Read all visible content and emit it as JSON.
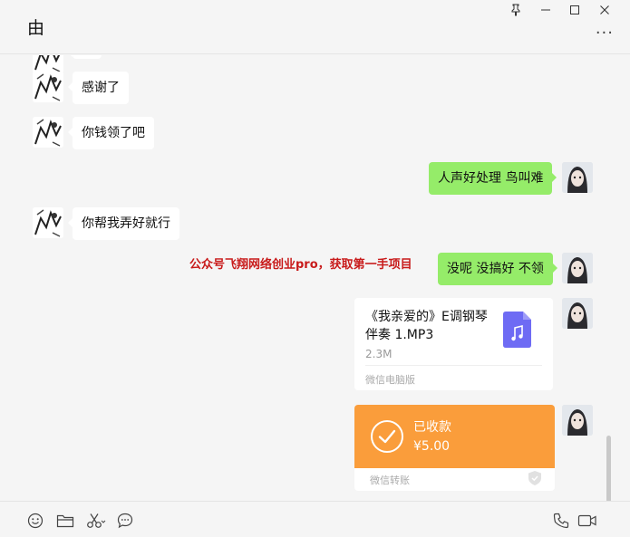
{
  "window": {
    "title": "由",
    "pin_icon": "pin-icon",
    "minimize_icon": "minimize-icon",
    "maximize_icon": "maximize-icon",
    "close_icon": "close-icon",
    "more_icon": "more-icon",
    "more_glyph": "···"
  },
  "messages": [
    {
      "side": "left",
      "text": "感谢了"
    },
    {
      "side": "left",
      "text": "你钱领了吧"
    },
    {
      "side": "right",
      "text": "人声好处理 鸟叫难"
    },
    {
      "side": "left",
      "text": "你帮我弄好就行"
    },
    {
      "side": "right",
      "text": "没呢 没搞好 不领"
    }
  ],
  "watermark": "公众号飞翔网络创业pro，获取第一手项目",
  "file": {
    "name": "《我亲爱的》E调钢琴伴奏 1.MP3",
    "size": "2.3M",
    "source": "微信电脑版",
    "icon": "music-file-icon",
    "icon_color": "#6e6bf4"
  },
  "transfer": {
    "status": "已收款",
    "amount": "¥5.00",
    "source": "微信转账",
    "color": "#fa9d3b",
    "icon": "check-circle-icon"
  },
  "toolbar": {
    "icons": [
      "emoji-icon",
      "folder-icon",
      "scissors-icon",
      "chat-history-icon",
      "phone-icon",
      "video-icon"
    ]
  },
  "colors": {
    "sent_bubble": "#95ec69",
    "received_bubble": "#ffffff",
    "background": "#f5f5f5"
  }
}
